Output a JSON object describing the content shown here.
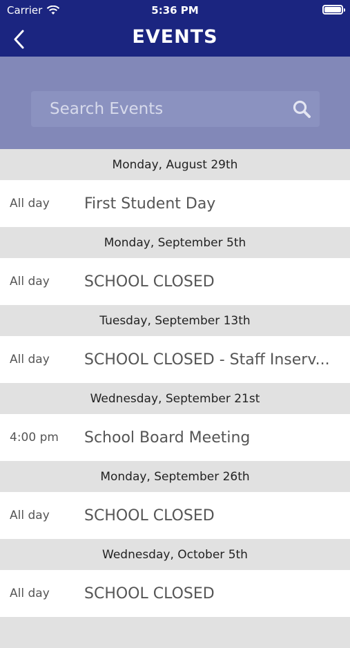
{
  "status_bar": {
    "carrier": "Carrier",
    "time": "5:36 PM"
  },
  "header": {
    "title": "EVENTS"
  },
  "search": {
    "placeholder": "Search Events"
  },
  "days": [
    {
      "date": "Monday, August 29th",
      "events": [
        {
          "time": "All day",
          "title": "First Student Day"
        }
      ]
    },
    {
      "date": "Monday, September 5th",
      "events": [
        {
          "time": "All day",
          "title": "SCHOOL CLOSED"
        }
      ]
    },
    {
      "date": "Tuesday, September 13th",
      "events": [
        {
          "time": "All day",
          "title": "SCHOOL CLOSED - Staff Inserv..."
        }
      ]
    },
    {
      "date": "Wednesday, September 21st",
      "events": [
        {
          "time": "4:00 pm",
          "title": "School Board Meeting"
        }
      ]
    },
    {
      "date": "Monday, September 26th",
      "events": [
        {
          "time": "All day",
          "title": "SCHOOL CLOSED"
        }
      ]
    },
    {
      "date": "Wednesday, October 5th",
      "events": [
        {
          "time": "All day",
          "title": "SCHOOL CLOSED"
        }
      ]
    }
  ],
  "colors": {
    "nav_bar": "#1b2580",
    "search_band": "#8288b8",
    "day_header_bg": "#e1e1e1"
  }
}
